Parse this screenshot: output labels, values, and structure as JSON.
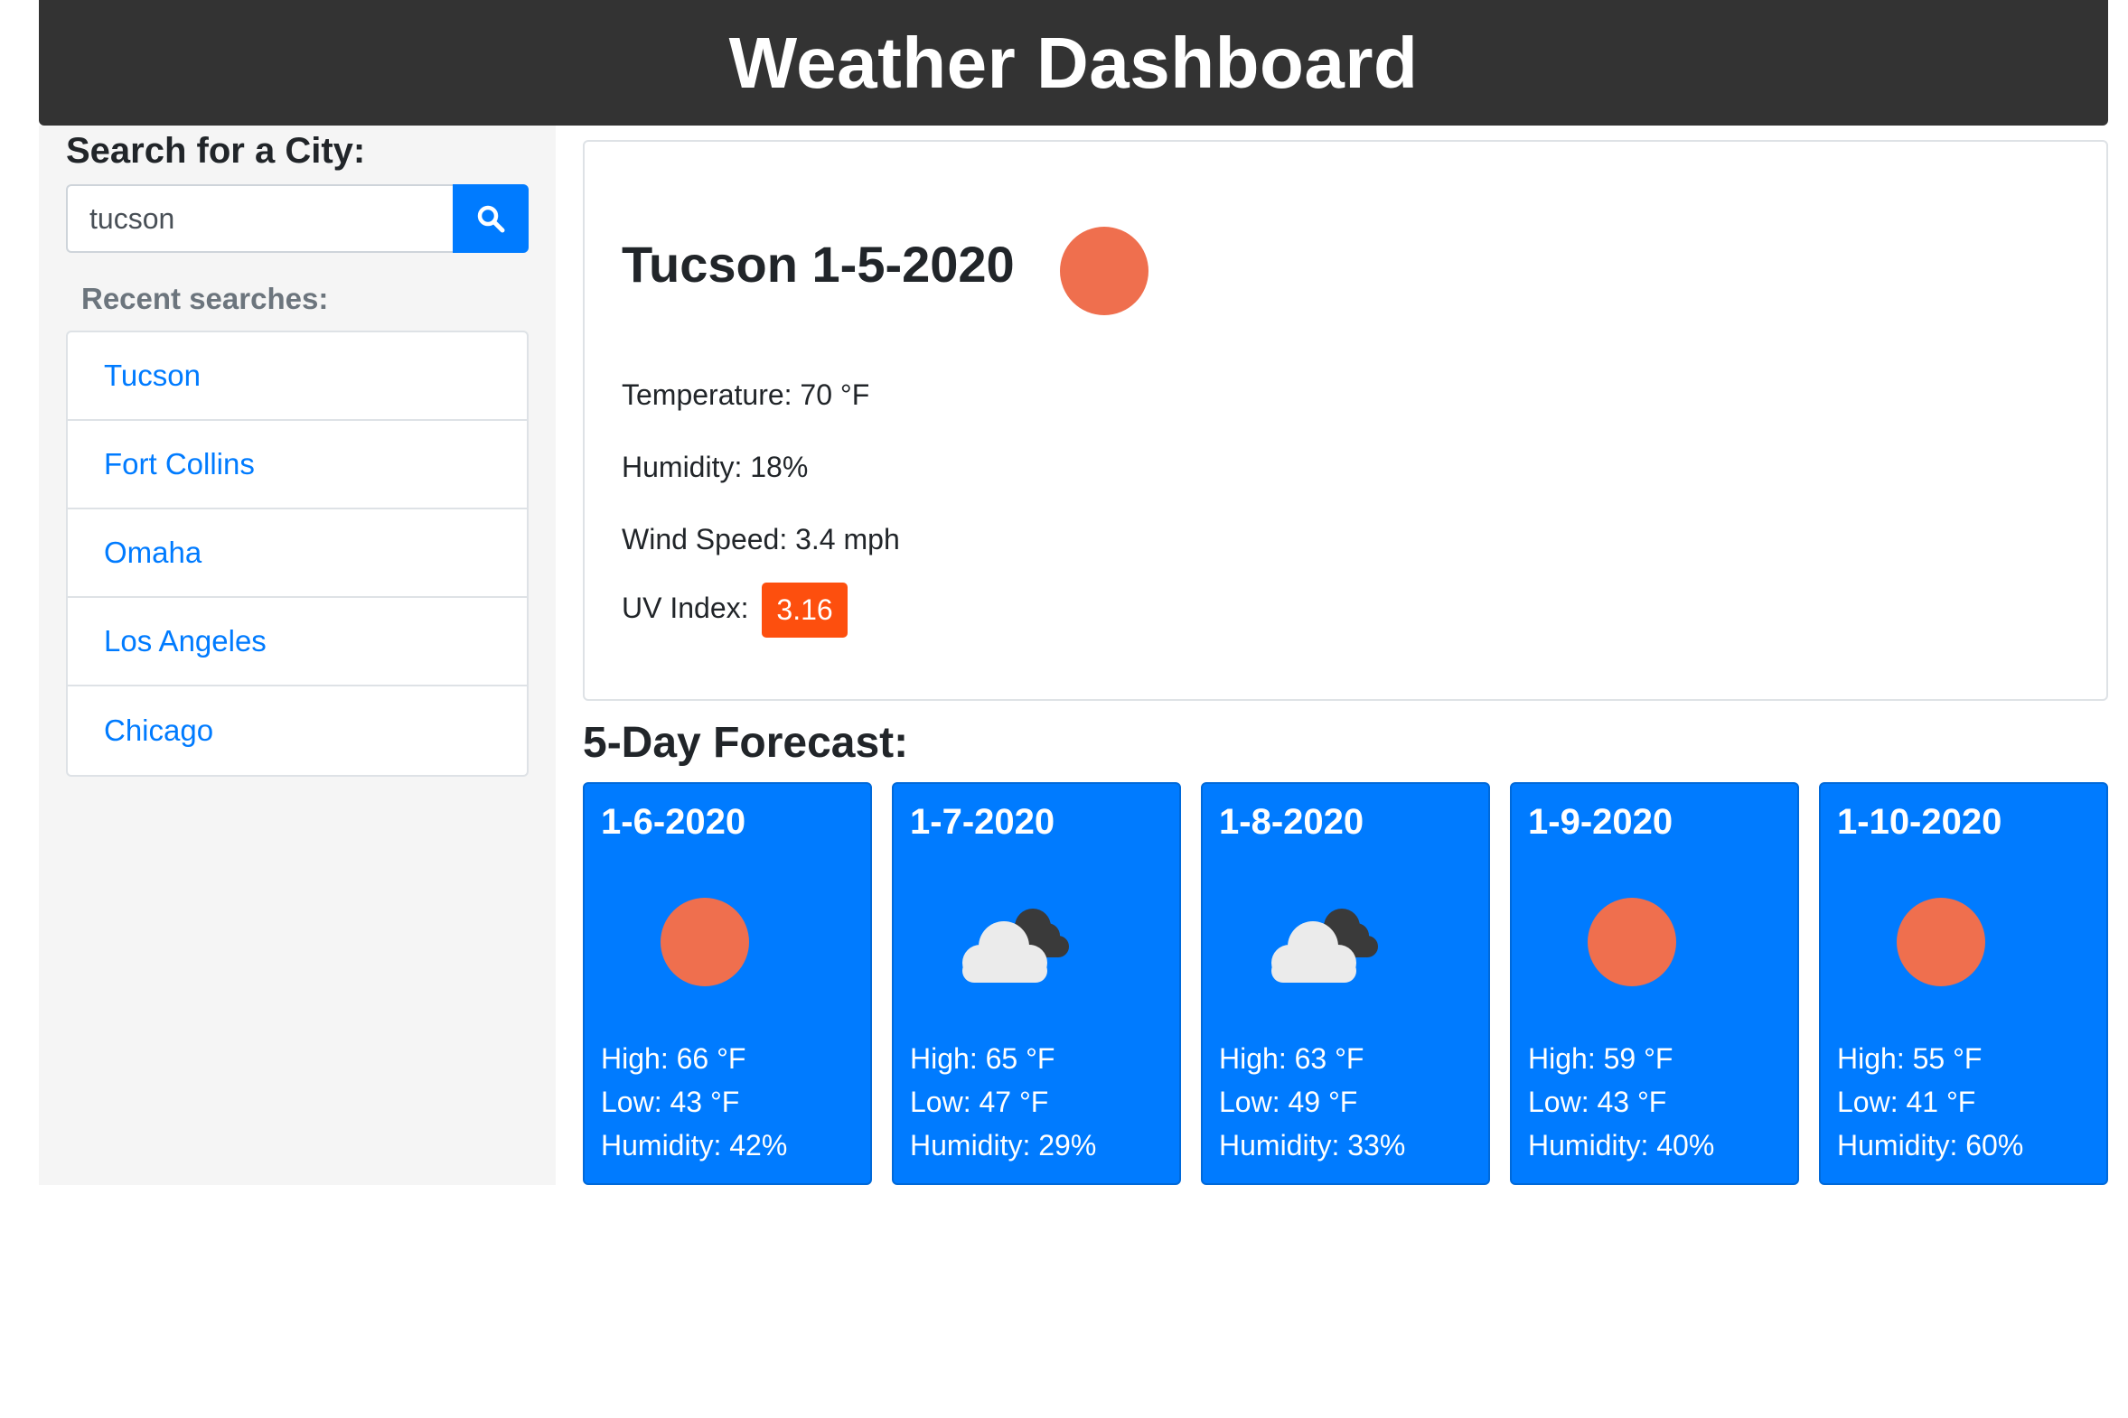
{
  "header": {
    "title": "Weather Dashboard"
  },
  "sidebar": {
    "search_title": "Search for a City:",
    "search_value": "tucson",
    "recent_title": "Recent searches:",
    "recent": [
      "Tucson",
      "Fort Collins",
      "Omaha",
      "Los Angeles",
      "Chicago"
    ]
  },
  "current": {
    "title": "Tucson 1-5-2020",
    "icon": "sun-icon",
    "temperature": "Temperature: 70 °F",
    "humidity": "Humidity: 18%",
    "wind": "Wind Speed: 3.4 mph",
    "uv_label": "UV Index:",
    "uv_value": "3.16"
  },
  "forecast_title": "5-Day Forecast:",
  "forecast": [
    {
      "date": "1-6-2020",
      "icon": "sun-icon",
      "high": "High: 66 °F",
      "low": "Low: 43 °F",
      "humidity": "Humidity: 42%"
    },
    {
      "date": "1-7-2020",
      "icon": "clouds-icon",
      "high": "High: 65 °F",
      "low": "Low: 47 °F",
      "humidity": "Humidity: 29%"
    },
    {
      "date": "1-8-2020",
      "icon": "clouds-icon",
      "high": "High: 63 °F",
      "low": "Low: 49 °F",
      "humidity": "Humidity: 33%"
    },
    {
      "date": "1-9-2020",
      "icon": "sun-icon",
      "high": "High: 59 °F",
      "low": "Low: 43 °F",
      "humidity": "Humidity: 40%"
    },
    {
      "date": "1-10-2020",
      "icon": "sun-icon",
      "high": "High: 55 °F",
      "low": "Low: 41 °F",
      "humidity": "Humidity: 60%"
    }
  ],
  "colors": {
    "header_bg": "#333333",
    "accent": "#007bff",
    "uv_badge": "#fd4f0e",
    "sun": "#ef6f4e"
  }
}
